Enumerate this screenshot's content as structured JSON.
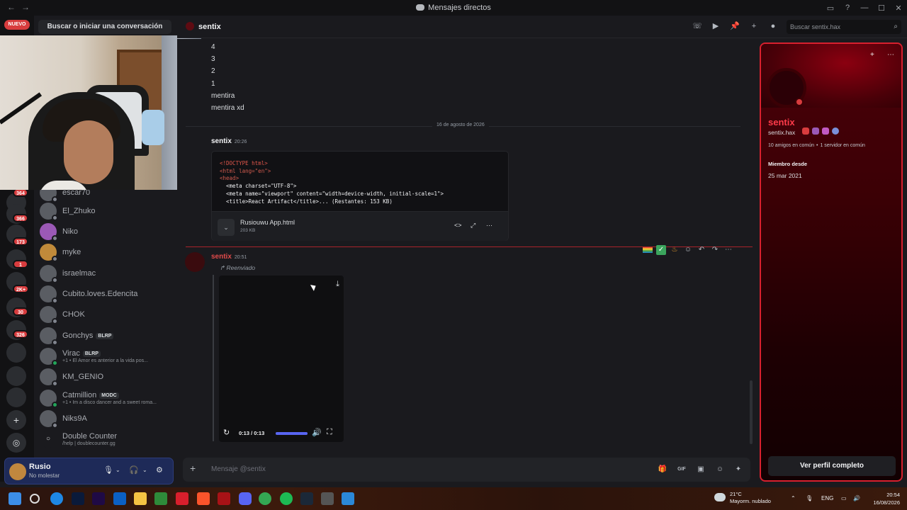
{
  "window": {
    "title": "Mensajes directos"
  },
  "rail": {
    "new_badge": "NUEVO",
    "badges": [
      "364",
      "366",
      "173",
      "1",
      "2K+",
      "30",
      "326"
    ]
  },
  "dm_list": {
    "search_label": "Buscar o iniciar una conversación",
    "items": [
      {
        "name": "escar70",
        "sub": "",
        "tag": ""
      },
      {
        "name": "El_Zhuko",
        "sub": "",
        "tag": ""
      },
      {
        "name": "Niko",
        "sub": "",
        "tag": ""
      },
      {
        "name": "myke",
        "sub": "",
        "tag": ""
      },
      {
        "name": "israelmac",
        "sub": "",
        "tag": ""
      },
      {
        "name": "Cubito.loves.Edencita",
        "sub": "",
        "tag": ""
      },
      {
        "name": "CHOK",
        "sub": "",
        "tag": ""
      },
      {
        "name": "Gonchys",
        "sub": "",
        "tag": "BLRP"
      },
      {
        "name": "Virac",
        "sub": "+1 • El Amor es anterior a la vida pos...",
        "tag": "BLRP"
      },
      {
        "name": "KM_GENIO",
        "sub": "",
        "tag": ""
      },
      {
        "name": "Catmillion",
        "sub": "+1 • Im a disco dancer and a sweet roma...",
        "tag": "MODC"
      },
      {
        "name": "Niks9A",
        "sub": "",
        "tag": ""
      },
      {
        "name": "Double Counter",
        "sub": "/help | doublecounter.gg",
        "tag": ""
      }
    ]
  },
  "user_panel": {
    "name": "Rusio",
    "status": "No molestar"
  },
  "header": {
    "channel_name": "sentix",
    "search_placeholder": "Buscar sentix.hax"
  },
  "messages": {
    "plain_lines": [
      "4",
      "3",
      "2",
      "1",
      "mentira",
      "mentira xd"
    ],
    "date_divider": "16 de agosto de 2026",
    "code_message": {
      "author": "sentix",
      "time": "20:26",
      "code_lines": [
        "<!DOCTYPE html>",
        "<html lang=\"en\">",
        "<head>",
        "  <meta charset=\"UTF-8\">",
        "  <meta name=\"viewport\" content=\"width=device-width, initial-scale=1\">",
        "  <title>React Artifact</title>... (Restantes: 153 KB)"
      ],
      "file_name": "Rusiouwu App.html",
      "file_size": "203 KB"
    },
    "video_message": {
      "author": "sentix",
      "time": "20:51",
      "forwarded_label": "Reenviado",
      "time_display": "0:13 / 0:13",
      "progress": 1.0
    }
  },
  "composer": {
    "placeholder": "Mensaje @sentix"
  },
  "profile": {
    "display_name": "sentix",
    "handle": "sentix.hax",
    "mutual_friends": "10 amigos en común",
    "mutual_servers": "1 servidor en común",
    "member_since_label": "Miembro desde",
    "member_since": "25 mar 2021",
    "full_profile_button": "Ver perfil completo"
  },
  "taskbar": {
    "weather_temp": "21°C",
    "weather_desc": "Mayorm. nublado",
    "lang": "ENG",
    "time": "20:54",
    "date": "16/08/2026"
  },
  "colors": {
    "accent": "#5865f2",
    "danger": "#d83c3e",
    "profile_border": "#d8202e",
    "author_red": "#e04a4a"
  }
}
